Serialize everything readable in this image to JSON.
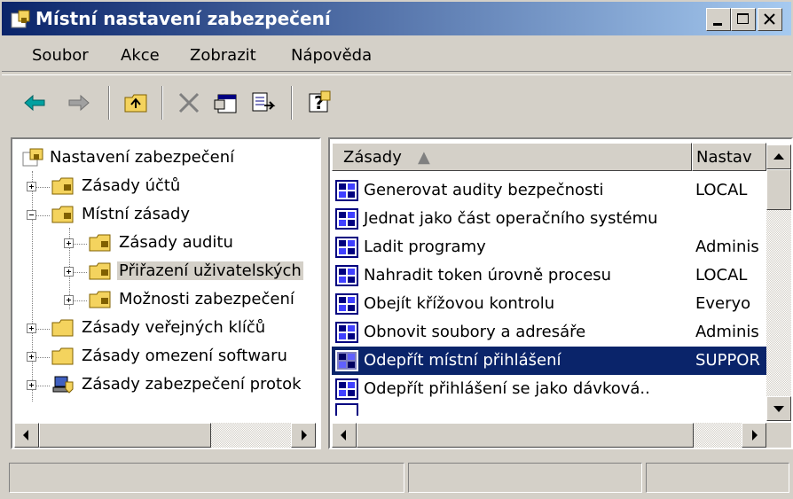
{
  "window": {
    "title": "Místní nastavení zabezpečení"
  },
  "menu": [
    "Soubor",
    "Akce",
    "Zobrazit",
    "Nápověda"
  ],
  "toolbar": [
    "back-arrow-icon",
    "forward-arrow-icon",
    "up-folder-icon",
    "delete-icon",
    "properties-icon",
    "export-list-icon",
    "help-icon"
  ],
  "tree": {
    "root": "Nastavení zabezpečení",
    "items": [
      {
        "label": "Zásady účtů",
        "level": 1,
        "expander": "plus"
      },
      {
        "label": "Místní zásady",
        "level": 1,
        "expander": "minus"
      },
      {
        "label": "Zásady auditu",
        "level": 2,
        "expander": "plus"
      },
      {
        "label": "Přiřazení uživatelských",
        "level": 2,
        "expander": "plus",
        "selected": true
      },
      {
        "label": "Možnosti zabezpečení",
        "level": 2,
        "expander": "plus"
      },
      {
        "label": "Zásady veřejných klíčů",
        "level": 1,
        "expander": "plus"
      },
      {
        "label": "Zásady omezení softwaru",
        "level": 1,
        "expander": "plus"
      },
      {
        "label": "Zásady zabezpečení protok",
        "level": 1,
        "expander": "plus"
      }
    ]
  },
  "list": {
    "columns": [
      "Zásady",
      "Nastav"
    ],
    "sort_indicator": "▲",
    "rows": [
      {
        "name": "Generovat audity bezpečnosti",
        "value": "LOCAL"
      },
      {
        "name": "Jednat jako část operačního systému",
        "value": ""
      },
      {
        "name": "Ladit programy",
        "value": "Adminis"
      },
      {
        "name": "Nahradit token úrovně procesu",
        "value": "LOCAL"
      },
      {
        "name": "Obejít křížovou kontrolu",
        "value": "Everyo"
      },
      {
        "name": "Obnovit soubory a adresáře",
        "value": "Adminis"
      },
      {
        "name": "Odepřít místní přihlášení",
        "value": "SUPPOR",
        "selected": true
      },
      {
        "name": "Odepřít přihlášení se jako dávková..",
        "value": ""
      }
    ]
  },
  "colors": {
    "title_start": "#0a246a",
    "title_end": "#a6caf0",
    "selection": "#0a246a",
    "face": "#d4d0c8"
  }
}
